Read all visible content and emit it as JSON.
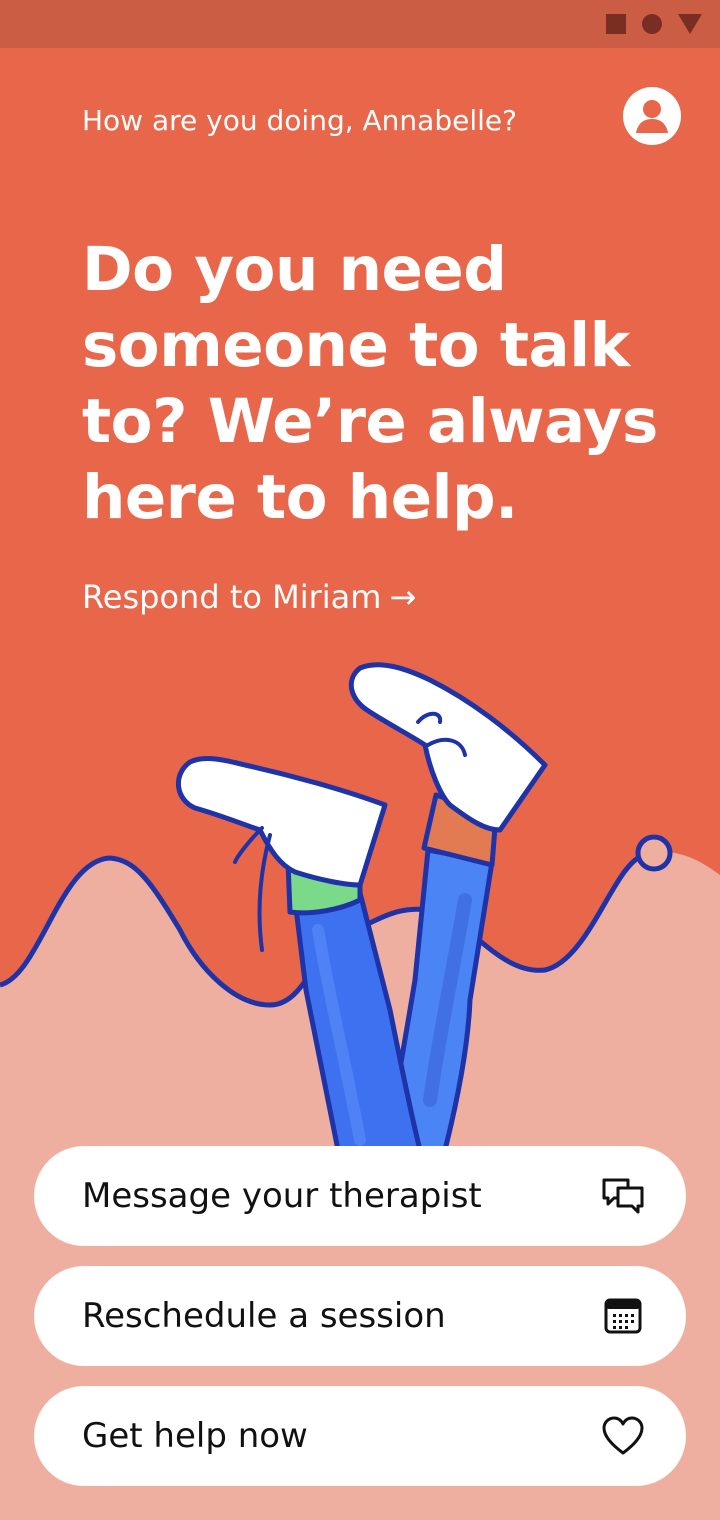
{
  "colors": {
    "status_bar": "#CC5D45",
    "hero": "#E8664A",
    "lower_bg": "#EEAFA0",
    "line": "#1E33A8",
    "pants": "#3D71F0",
    "sock_green": "#7BD98A",
    "sock_orange": "#E27B52",
    "button_bg": "#FFFFFF"
  },
  "status_bar": {
    "icons": [
      "square-icon",
      "circle-icon",
      "triangle-icon"
    ]
  },
  "header": {
    "greeting": "How are you doing, Annabelle?",
    "avatar_icon": "user-avatar-icon"
  },
  "hero": {
    "headline": "Do you need someone to talk to? We’re always here to help.",
    "respond_link": "Respond to Miriam",
    "respond_arrow": "→"
  },
  "actions": [
    {
      "label": "Message your therapist",
      "icon": "chat-bubbles-icon"
    },
    {
      "label": "Reschedule a session",
      "icon": "calendar-icon"
    },
    {
      "label": "Get help now",
      "icon": "heart-icon"
    }
  ]
}
